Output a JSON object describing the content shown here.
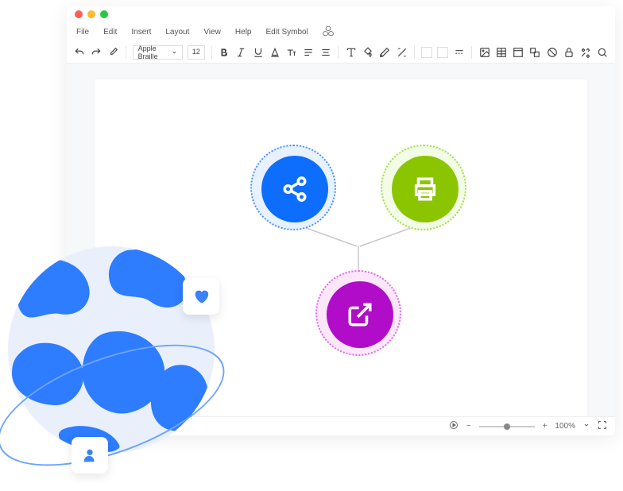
{
  "menubar": {
    "file": "File",
    "edit": "Edit",
    "insert": "Insert",
    "layout": "Layout",
    "view": "View",
    "help": "Help",
    "edit_symbol": "Edit Symbol"
  },
  "toolbar": {
    "font_family": "Apple Braille",
    "font_size": "12"
  },
  "statusbar": {
    "zoom_value": "100%"
  },
  "nodes": {
    "share": "share-icon",
    "print": "print-icon",
    "external": "external-link-icon"
  }
}
